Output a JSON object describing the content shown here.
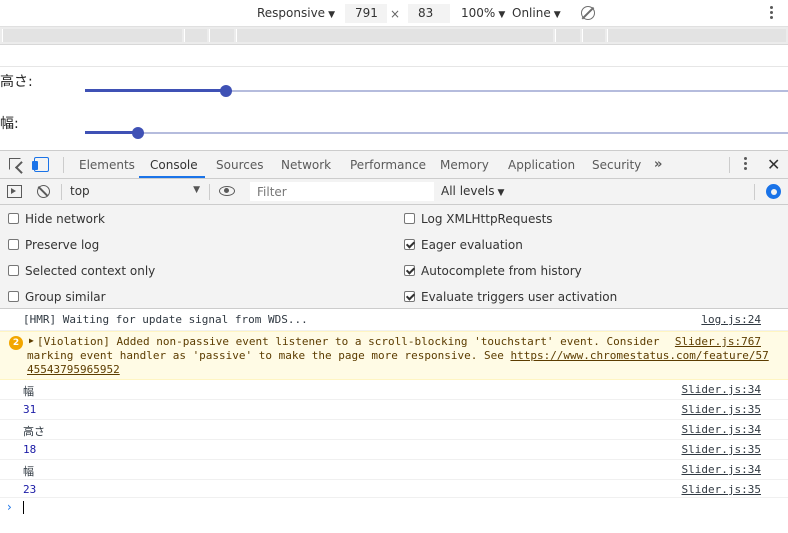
{
  "device_toolbar": {
    "device": "Responsive",
    "width": "791",
    "times": "×",
    "height": "83",
    "zoom": "100%",
    "network": "Online"
  },
  "page": {
    "sliders": [
      {
        "label": "高さ:",
        "value_fraction": 0.2
      },
      {
        "label": "幅:",
        "value_fraction": 0.075
      }
    ]
  },
  "devtools": {
    "tabs": [
      "Elements",
      "Console",
      "Sources",
      "Network",
      "Performance",
      "Memory",
      "Application",
      "Security"
    ],
    "active_tab": "Console",
    "more_tabs": "»"
  },
  "console_toolbar": {
    "context": "top",
    "filter_placeholder": "Filter",
    "levels": "All levels"
  },
  "settings": {
    "left": [
      {
        "label": "Hide network",
        "checked": false
      },
      {
        "label": "Preserve log",
        "checked": false
      },
      {
        "label": "Selected context only",
        "checked": false
      },
      {
        "label": "Group similar",
        "checked": false
      }
    ],
    "right": [
      {
        "label": "Log XMLHttpRequests",
        "checked": false
      },
      {
        "label": "Eager evaluation",
        "checked": true
      },
      {
        "label": "Autocomplete from history",
        "checked": true
      },
      {
        "label": "Evaluate triggers user activation",
        "checked": true
      }
    ]
  },
  "console": {
    "hmr": {
      "text": "[HMR] Waiting for update signal from WDS...",
      "source": "log.js:24"
    },
    "violation": {
      "count": "2",
      "line1": "[Violation] Added non-passive event listener to a scroll-blocking 'touchstart' event. Consider",
      "line2_prefix": "marking event handler as 'passive' to make the page more responsive. See ",
      "link_part1": "https://www.chromestatus.com/feature/57",
      "link_part2": "45543795965952",
      "source": "Slider.js:767"
    },
    "logs": [
      {
        "text": "幅",
        "source": "Slider.js:34",
        "numeric": false
      },
      {
        "text": "31",
        "source": "Slider.js:35",
        "numeric": true
      },
      {
        "text": "高さ",
        "source": "Slider.js:34",
        "numeric": false
      },
      {
        "text": "18",
        "source": "Slider.js:35",
        "numeric": true
      },
      {
        "text": "幅",
        "source": "Slider.js:34",
        "numeric": false
      },
      {
        "text": "23",
        "source": "Slider.js:35",
        "numeric": true
      }
    ],
    "prompt": "›"
  }
}
